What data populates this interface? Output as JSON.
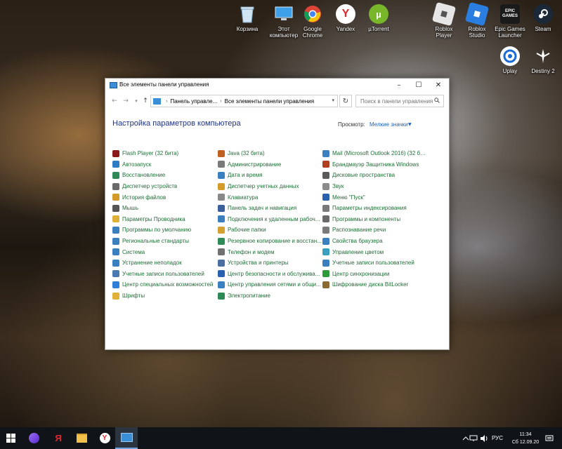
{
  "desktop": {
    "icons": [
      {
        "label": "Корзина",
        "icon": "recycle-bin-icon"
      },
      {
        "label": "Этот компьютер",
        "icon": "computer-icon"
      },
      {
        "label": "Google Chrome",
        "icon": "chrome-icon"
      },
      {
        "label": "Yandex",
        "icon": "yandex-icon"
      },
      {
        "label": "µTorrent",
        "icon": "utorrent-icon"
      },
      {
        "label": "Roblox Player",
        "icon": "roblox-icon"
      },
      {
        "label": "Roblox Studio",
        "icon": "roblox-studio-icon"
      },
      {
        "label": "Epic Games Launcher",
        "icon": "epic-games-icon"
      },
      {
        "label": "Steam",
        "icon": "steam-icon"
      },
      {
        "label": "Uplay",
        "icon": "uplay-icon"
      },
      {
        "label": "Destiny 2",
        "icon": "destiny-icon"
      }
    ],
    "epic_logo": "EPIC GAMES"
  },
  "window": {
    "title": "Все элементы панели управления",
    "address": {
      "segments": [
        "Панель управле...",
        "Все элементы панели управления"
      ]
    },
    "search_placeholder": "Поиск в панели управления",
    "heading": "Настройка параметров компьютера",
    "view_label": "Просмотр:",
    "view_value": "Мелкие значки",
    "columns": [
      [
        "Flash Player (32 бита)",
        "Автозапуск",
        "Восстановление",
        "Диспетчер устройств",
        "История файлов",
        "Мышь",
        "Параметры Проводника",
        "Программы по умолчанию",
        "Региональные стандарты",
        "Система",
        "Устранение неполадок",
        "Учетные записи пользователей",
        "Центр специальных возможностей",
        "Шрифты"
      ],
      [
        "Java (32 бита)",
        "Администрирование",
        "Дата и время",
        "Диспетчер учетных данных",
        "Клавиатура",
        "Панель задач и навигация",
        "Подключения к удаленным рабоч...",
        "Рабочие папки",
        "Резервное копирование и восстан...",
        "Телефон и модем",
        "Устройства и принтеры",
        "Центр безопасности и обслужива...",
        "Центр управления сетями и общи...",
        "Электропитание"
      ],
      [
        "Mail (Microsoft Outlook 2016) (32 би...",
        "Брандмауэр Защитника Windows",
        "Дисковые пространства",
        "Звук",
        "Меню \"Пуск\"",
        "Параметры индексирования",
        "Программы и компоненты",
        "Распознавание речи",
        "Свойства браузера",
        "Управление цветом",
        "Учетные записи пользователей",
        "Центр синхронизации",
        "Шифрование диска BitLocker"
      ]
    ],
    "icon_colors": [
      [
        "#8b1a1a",
        "#2d7bc4",
        "#2e8b57",
        "#6a6a6a",
        "#d49a2a",
        "#555555",
        "#e0b13a",
        "#3a7fc0",
        "#3a7fc0",
        "#3a7fc0",
        "#3a7fc0",
        "#4a78b0",
        "#2f7ed8",
        "#e0b13a"
      ],
      [
        "#c06020",
        "#7a7a7a",
        "#3a7fc0",
        "#d49a2a",
        "#888888",
        "#3a5f9a",
        "#3a7fc0",
        "#d4a030",
        "#2e8b57",
        "#707070",
        "#4a6fa0",
        "#2a60b0",
        "#3a7fc0",
        "#2e8b57"
      ],
      [
        "#3a7fc0",
        "#b04020",
        "#5a5a5a",
        "#8a8a8a",
        "#2a60b0",
        "#7a7a7a",
        "#6a6a6a",
        "#7a7a7a",
        "#3a7fc0",
        "#3aa0c0",
        "#3a7fc0",
        "#2e9b3a",
        "#8a6a30"
      ]
    ]
  },
  "taskbar": {
    "items": [
      "start-icon",
      "cortana-icon",
      "yandex-icon",
      "file-explorer-icon",
      "yandex-browser-icon",
      "control-panel-icon"
    ],
    "language": "РУС",
    "time": "11:34",
    "date": "Сб 12.09.20"
  }
}
